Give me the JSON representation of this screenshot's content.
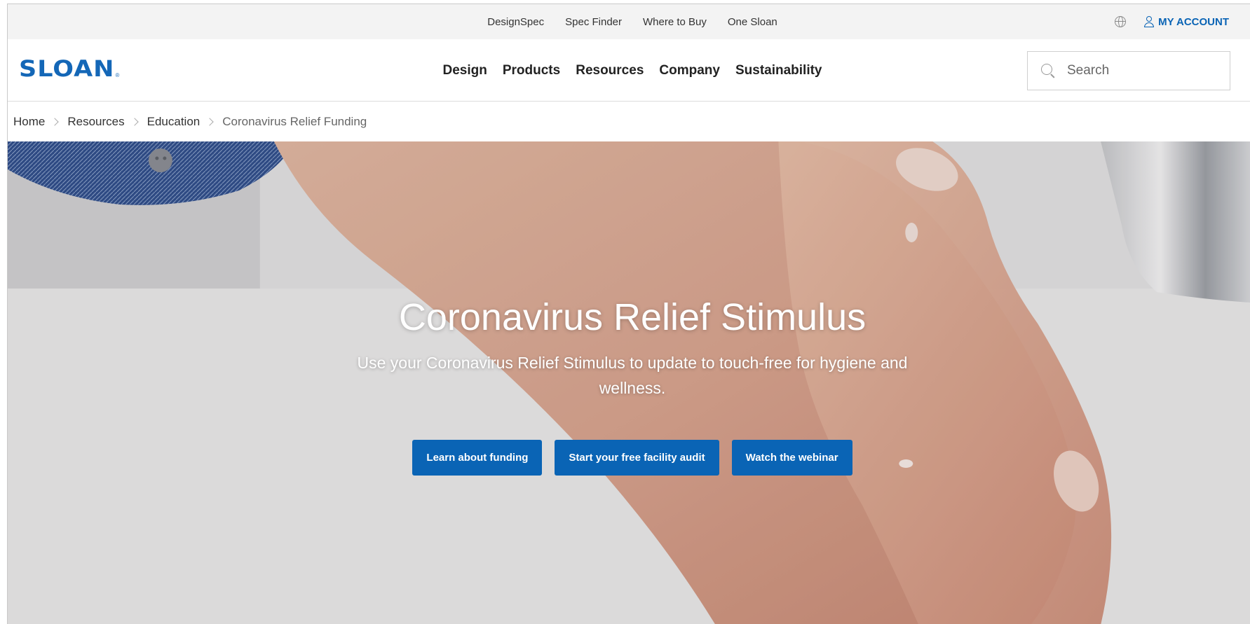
{
  "utility_nav": {
    "links": [
      "DesignSpec",
      "Spec Finder",
      "Where to Buy",
      "One Sloan"
    ],
    "account_label": "MY ACCOUNT"
  },
  "brand": {
    "logo_text": "SLOAN",
    "logo_mark": "®",
    "color": "#1467b7"
  },
  "primary_nav": {
    "items": [
      "Design",
      "Products",
      "Resources",
      "Company",
      "Sustainability"
    ]
  },
  "search": {
    "placeholder": "Search"
  },
  "breadcrumb": {
    "items": [
      "Home",
      "Resources",
      "Education"
    ],
    "current": "Coronavirus Relief Funding"
  },
  "hero": {
    "title": "Coronavirus Relief Stimulus",
    "subtitle": "Use your Coronavirus Relief Stimulus to update to touch-free for hygiene and wellness.",
    "buttons": [
      "Learn about funding",
      "Start your free facility audit",
      "Watch the webinar"
    ],
    "button_color": "#0a64b5"
  },
  "icons": {
    "globe": "globe-icon",
    "user": "user-icon",
    "search": "search-icon",
    "breadcrumb_separator": "chevron-right-icon"
  }
}
